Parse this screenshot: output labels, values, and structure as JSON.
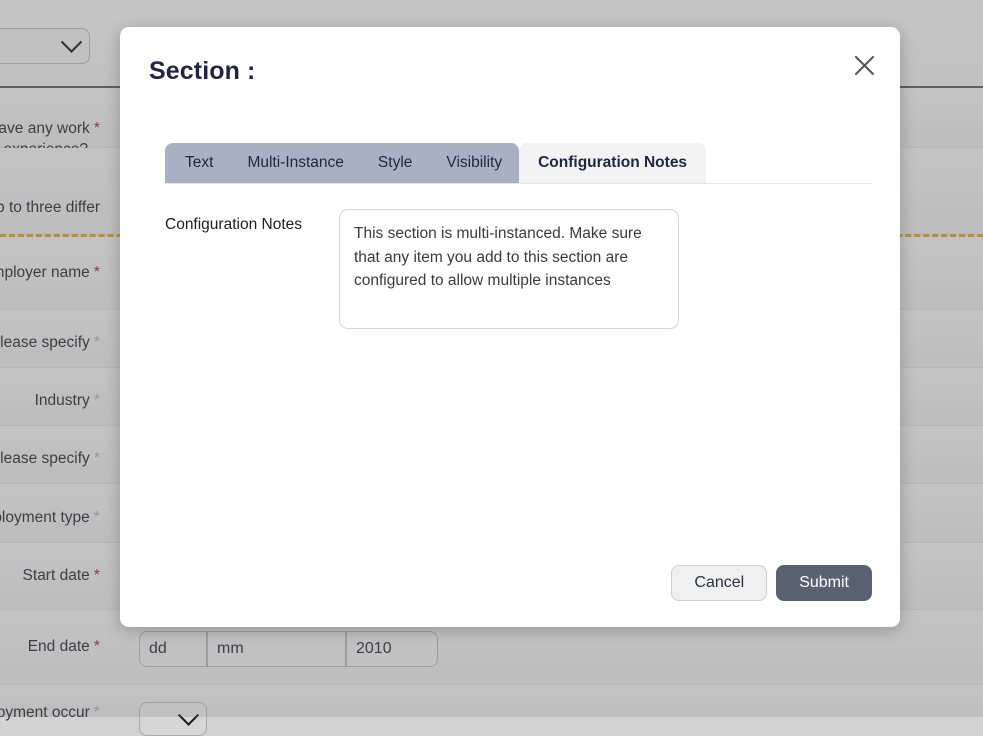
{
  "modal": {
    "title": "Section :",
    "close_icon": "close-icon",
    "tabs": [
      {
        "label": "Text",
        "active": false
      },
      {
        "label": "Multi-Instance",
        "active": false
      },
      {
        "label": "Style",
        "active": false
      },
      {
        "label": "Visibility",
        "active": false
      },
      {
        "label": "Configuration Notes",
        "active": true
      }
    ],
    "field": {
      "label": "Configuration Notes",
      "value": "This section is multi-instanced. Make sure that any item you add to this section are configured to allow multiple instances",
      "placeholder": ""
    },
    "footer": {
      "cancel_label": "Cancel",
      "submit_label": "Submit"
    },
    "colors": {
      "tab_inactive_bg": "#a8b1c4",
      "tab_active_bg": "#f3f3f3",
      "submit_bg": "#5a6172",
      "cancel_bg": "#f0f0f0",
      "title_color": "#1f2544"
    }
  },
  "background_form": {
    "top_select_value": "",
    "rows": [
      {
        "label": "have any work",
        "label2": "experience?",
        "required": true,
        "required_color": "#9b2c2c"
      },
      {
        "label": "p to three differ",
        "label2": "",
        "required": false
      },
      {
        "label": "Employer name",
        "label2": "",
        "required": true,
        "required_color": "#9b2c2c"
      },
      {
        "label": "er please specify",
        "label2": "",
        "required": true,
        "required_color": "#a0a0a0"
      },
      {
        "label": "Industry",
        "label2": "",
        "required": true,
        "required_color": "#a0a0a0"
      },
      {
        "label": "er please specify",
        "label2": "",
        "required": true,
        "required_color": "#a0a0a0"
      },
      {
        "label": "mployment type",
        "label2": "",
        "required": true,
        "required_color": "#a0a0a0"
      },
      {
        "label": "Start date",
        "label2": "",
        "required": true,
        "required_color": "#9b2c2c"
      },
      {
        "label": "End date",
        "label2": "",
        "required": true,
        "required_color": "#9b2c2c"
      },
      {
        "label": "ployment occur",
        "label2": "",
        "required": true,
        "required_color": "#a0a0a0"
      }
    ],
    "end_date": {
      "day": "dd",
      "month": "mm",
      "year": "2010"
    },
    "dashed_separator_color": "#c79a28"
  }
}
